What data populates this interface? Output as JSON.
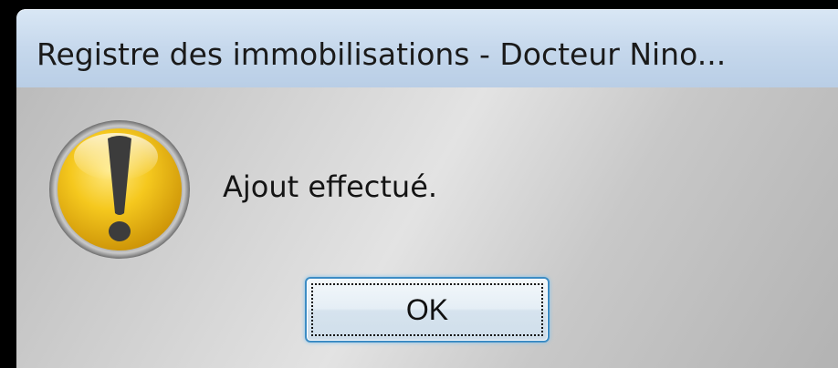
{
  "dialog": {
    "title": "Registre des immobilisations - Docteur Nino...",
    "icon": "warning-icon",
    "message": "Ajout effectué.",
    "ok_label": "OK"
  },
  "colors": {
    "title_bar": "#c6d8ec",
    "icon_yellow": "#f2c51c",
    "button_border": "#3d8cc4"
  }
}
